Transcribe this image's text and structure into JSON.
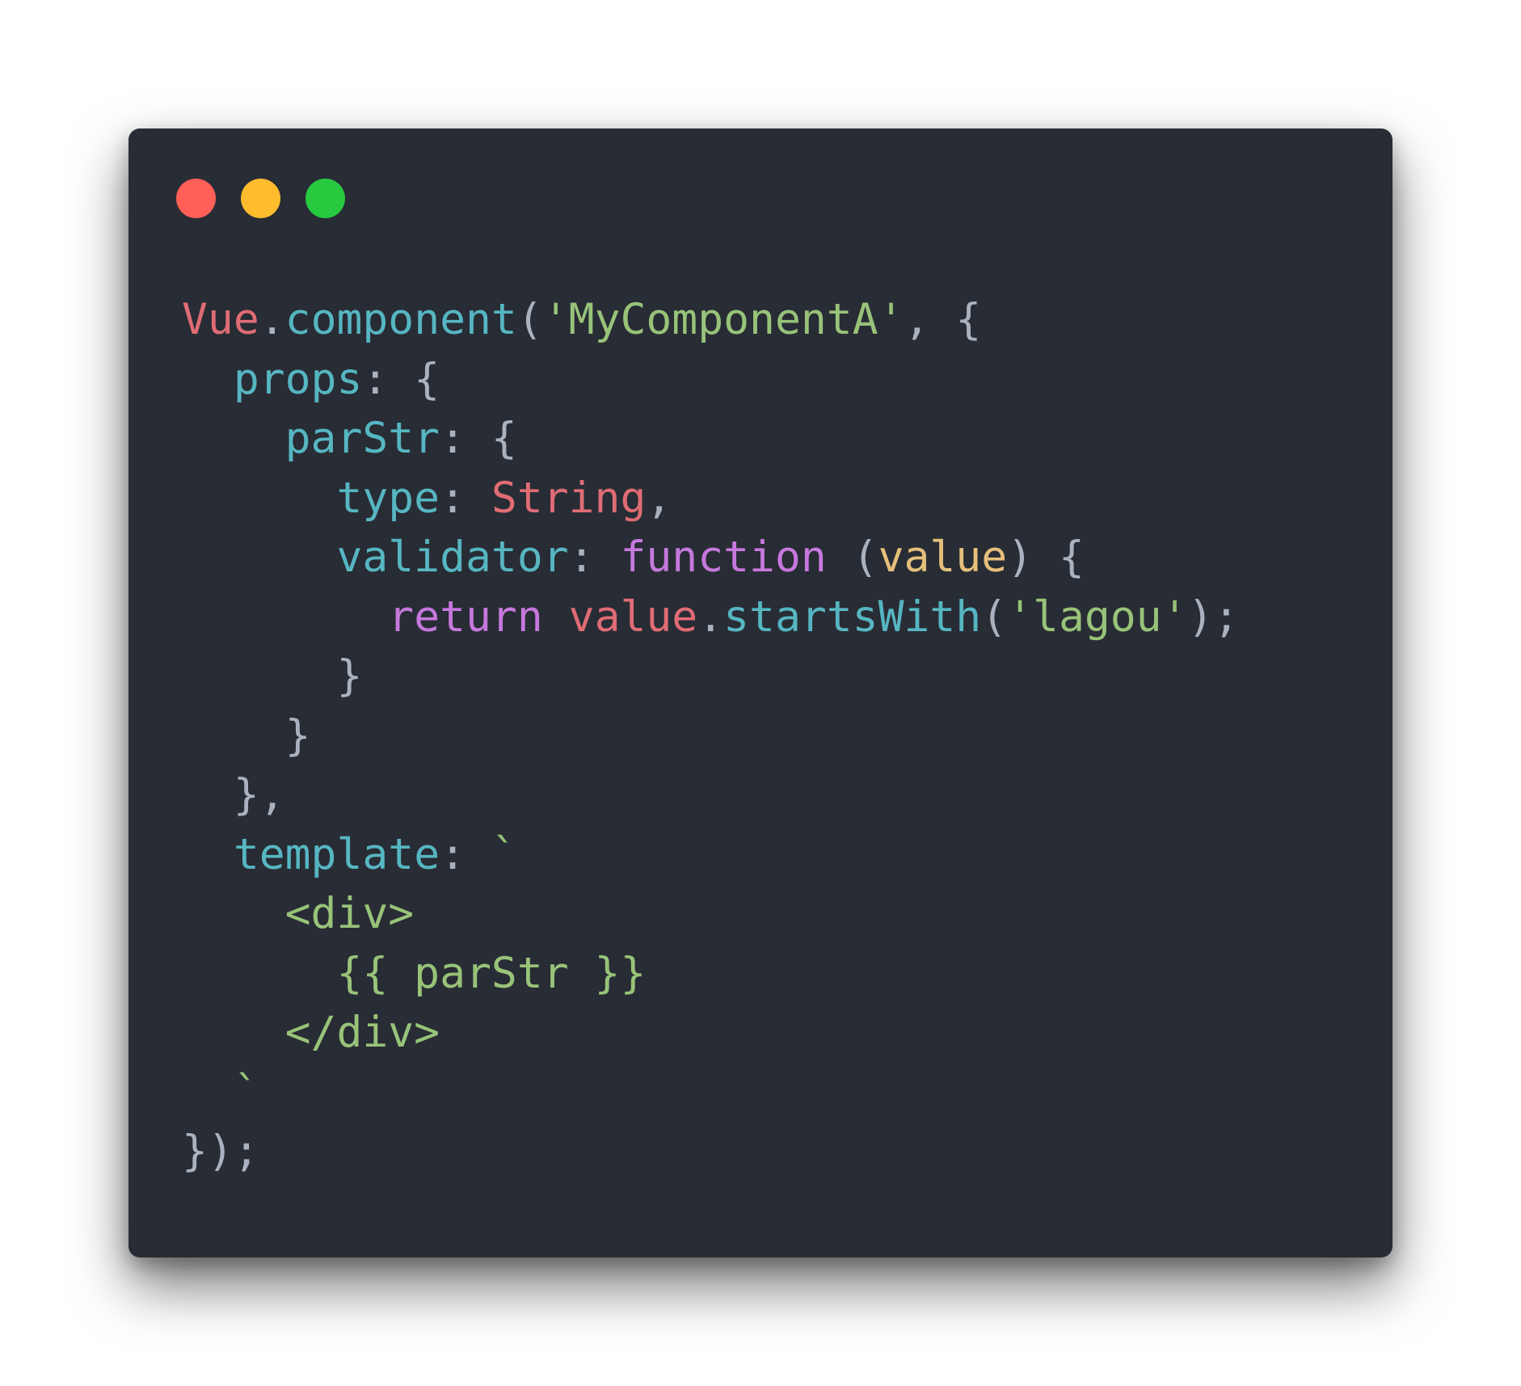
{
  "window": {
    "controls": [
      {
        "name": "close",
        "color": "#ff5f56"
      },
      {
        "name": "minimize",
        "color": "#ffbd2e"
      },
      {
        "name": "maximize",
        "color": "#27c93f"
      }
    ]
  },
  "colors": {
    "background": "#282c34",
    "object": "#e06c75",
    "property": "#56b6c2",
    "string": "#98c379",
    "keyword": "#c678dd",
    "parameter": "#e5c07b",
    "punctuation": "#abb2bf"
  },
  "code": {
    "lines": [
      [
        {
          "text": "Vue",
          "type": "obj"
        },
        {
          "text": ".",
          "type": "punc"
        },
        {
          "text": "component",
          "type": "prop"
        },
        {
          "text": "(",
          "type": "punc"
        },
        {
          "text": "'MyComponentA'",
          "type": "str"
        },
        {
          "text": ", {",
          "type": "punc"
        }
      ],
      [
        {
          "text": "  ",
          "type": "punc"
        },
        {
          "text": "props",
          "type": "prop"
        },
        {
          "text": ": {",
          "type": "punc"
        }
      ],
      [
        {
          "text": "    ",
          "type": "punc"
        },
        {
          "text": "parStr",
          "type": "prop"
        },
        {
          "text": ": {",
          "type": "punc"
        }
      ],
      [
        {
          "text": "      ",
          "type": "punc"
        },
        {
          "text": "type",
          "type": "prop"
        },
        {
          "text": ": ",
          "type": "punc"
        },
        {
          "text": "String",
          "type": "obj"
        },
        {
          "text": ",",
          "type": "punc"
        }
      ],
      [
        {
          "text": "      ",
          "type": "punc"
        },
        {
          "text": "validator",
          "type": "prop"
        },
        {
          "text": ": ",
          "type": "punc"
        },
        {
          "text": "function",
          "type": "kw"
        },
        {
          "text": " (",
          "type": "punc"
        },
        {
          "text": "value",
          "type": "param"
        },
        {
          "text": ") {",
          "type": "punc"
        }
      ],
      [
        {
          "text": "        ",
          "type": "punc"
        },
        {
          "text": "return",
          "type": "kw"
        },
        {
          "text": " ",
          "type": "punc"
        },
        {
          "text": "value",
          "type": "obj"
        },
        {
          "text": ".",
          "type": "punc"
        },
        {
          "text": "startsWith",
          "type": "prop"
        },
        {
          "text": "(",
          "type": "punc"
        },
        {
          "text": "'lagou'",
          "type": "str"
        },
        {
          "text": ");",
          "type": "punc"
        }
      ],
      [
        {
          "text": "      }",
          "type": "punc"
        }
      ],
      [
        {
          "text": "    }",
          "type": "punc"
        }
      ],
      [
        {
          "text": "  },",
          "type": "punc"
        }
      ],
      [
        {
          "text": "  ",
          "type": "punc"
        },
        {
          "text": "template",
          "type": "prop"
        },
        {
          "text": ": ",
          "type": "punc"
        },
        {
          "text": "`",
          "type": "str"
        }
      ],
      [
        {
          "text": "    <div>",
          "type": "str"
        }
      ],
      [
        {
          "text": "      {{ parStr }}",
          "type": "str"
        }
      ],
      [
        {
          "text": "    </div>",
          "type": "str"
        }
      ],
      [
        {
          "text": "  `",
          "type": "str"
        }
      ],
      [
        {
          "text": "});",
          "type": "punc"
        }
      ]
    ]
  }
}
